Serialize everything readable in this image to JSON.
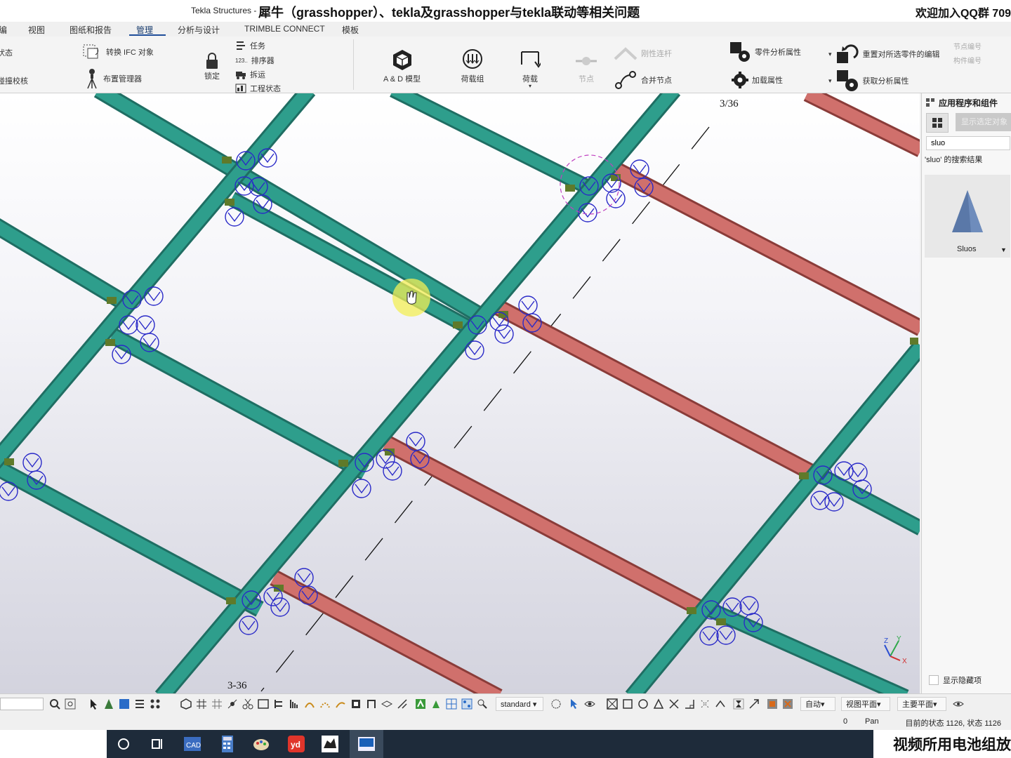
{
  "window": {
    "app_title": "Tekla Structures -",
    "overlay_title": "犀牛（grasshopper）、tekla及grasshopper与tekla联动等相关问题",
    "overlay_right": "欢迎加入QQ群  709"
  },
  "menu": {
    "tabs": [
      {
        "label": "编"
      },
      {
        "label": "视图"
      },
      {
        "label": "图纸和报告"
      },
      {
        "label": "管理"
      },
      {
        "label": "分析与设计"
      },
      {
        "label": "TRIMBLE CONNECT"
      },
      {
        "label": "模板"
      }
    ],
    "active_tab": "管理"
  },
  "ribbon": {
    "left_partial_1": "状态",
    "left_partial_2": "碰撞校核",
    "convert_ifc": "转换 IFC 对象",
    "layout_manager": "布置管理器",
    "lock": "锁定",
    "tasks": "任务",
    "sequencer": "排序器",
    "sequencer_prefix": "123..",
    "transport": "拆运",
    "project_status": "工程状态",
    "ad_model": "A & D 模型",
    "load_groups": "荷载组",
    "loads": "荷载",
    "nodes": "节点",
    "rigid_link": "刚性连杆",
    "merge_nodes": "合并节点",
    "part_analysis_props": "零件分析属性",
    "load_props": "加载属性",
    "reset_editing": "重置对所选零件的编辑",
    "get_analysis_props": "获取分析属性",
    "node_number": "节点编号",
    "member_number": "构件编号"
  },
  "viewport": {
    "grid_label_top": "3/36",
    "grid_label_bottom": "3-36",
    "axis_z": "Z",
    "axis_y": "Y",
    "axis_x": "X"
  },
  "right_panel": {
    "title": "应用程序和组件",
    "show_selected": "显示选定对象",
    "search_value": "sluo",
    "search_results": "'sluo' 的搜索结果",
    "card_label": "Sluos",
    "show_hidden": "显示隐藏项"
  },
  "toolbar": {
    "standard": "standard",
    "auto": "自动",
    "view_plane": "视图平面",
    "main_plane": "主要平面"
  },
  "status": {
    "zero": "0",
    "mode": "Pan",
    "state": "目前的状态 1126, 状态 1126"
  },
  "caption": "视频所用电池组放",
  "colors": {
    "beam_teal": "#2e9e8c",
    "beam_red": "#d0706c",
    "accent_blue": "#1f4e9a",
    "symbol_blue": "#2222cc"
  }
}
